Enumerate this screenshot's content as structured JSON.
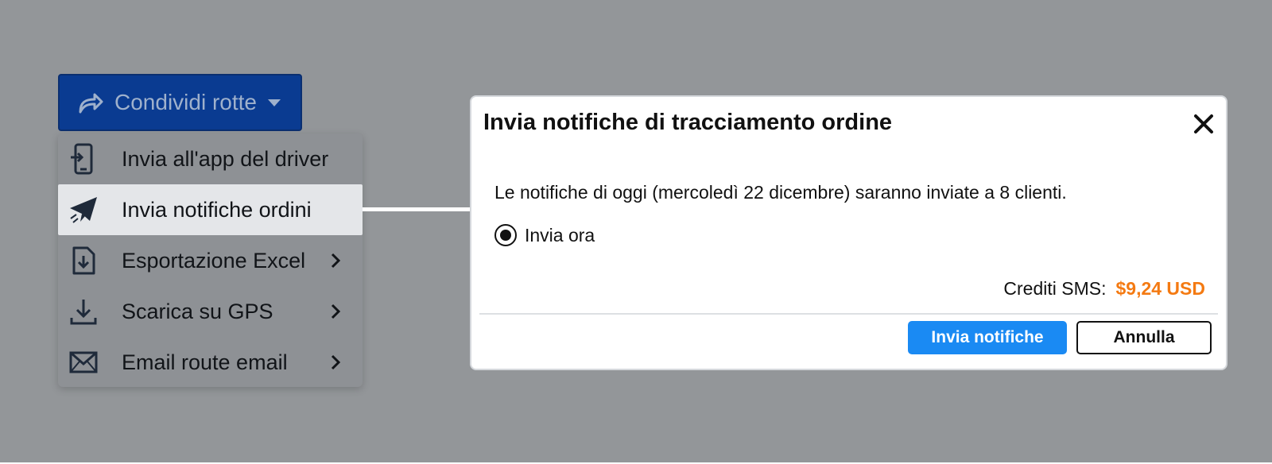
{
  "share_button": {
    "label": "Condividi rotte",
    "icon": "share-arrow-icon"
  },
  "menu": {
    "items": [
      {
        "label": "Invia all'app del driver",
        "icon": "mobile-send-icon",
        "submenu": false,
        "active": false
      },
      {
        "label": "Invia notifiche ordini",
        "icon": "paper-plane-icon",
        "submenu": false,
        "active": true
      },
      {
        "label": "Esportazione Excel",
        "icon": "file-download-icon",
        "submenu": true,
        "active": false
      },
      {
        "label": "Scarica su GPS",
        "icon": "download-icon",
        "submenu": true,
        "active": false
      },
      {
        "label": "Email route email",
        "icon": "envelope-icon",
        "submenu": true,
        "active": false
      }
    ]
  },
  "dialog": {
    "title": "Invia notifiche di tracciamento ordine",
    "message": "Le notifiche di oggi (mercoledì 22 dicembre) saranno inviate a 8 clienti.",
    "radio_label": "Invia ora",
    "radio_selected": true,
    "credits_label": "Crediti SMS:",
    "credits_value": "$9,24 USD",
    "primary_button": "Invia notifiche",
    "cancel_button": "Annulla"
  },
  "colors": {
    "backdrop": "#939699",
    "share_button_bg": "#0a3b91",
    "primary_button": "#1a8af3",
    "credits_amount": "#f47a12"
  }
}
